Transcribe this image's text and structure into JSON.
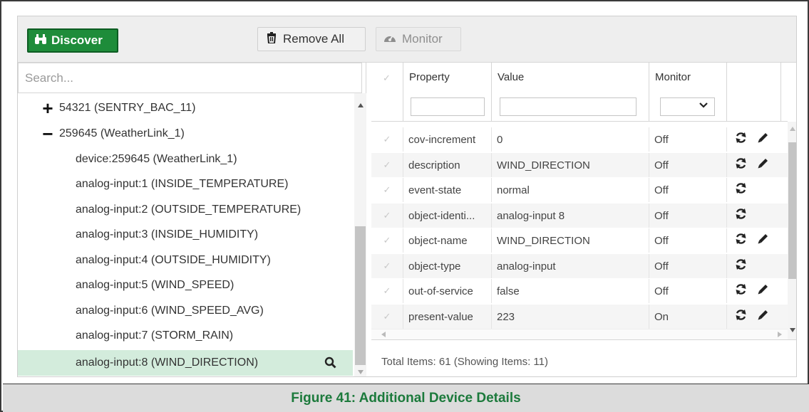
{
  "toolbar": {
    "discover_label": "Discover",
    "remove_all_label": "Remove All",
    "monitor_label": "Monitor"
  },
  "tree": {
    "search_placeholder": "Search...",
    "nodes": [
      {
        "expander": "+",
        "label": "54321 (SENTRY_BAC_11)"
      },
      {
        "expander": "−",
        "label": "259645 (WeatherLink_1)"
      },
      {
        "label": "device:259645 (WeatherLink_1)"
      },
      {
        "label": "analog-input:1 (INSIDE_TEMPERATURE)"
      },
      {
        "label": "analog-input:2 (OUTSIDE_TEMPERATURE)"
      },
      {
        "label": "analog-input:3 (INSIDE_HUMIDITY)"
      },
      {
        "label": "analog-input:4 (OUTSIDE_HUMIDITY)"
      },
      {
        "label": "analog-input:5 (WIND_SPEED)"
      },
      {
        "label": "analog-input:6 (WIND_SPEED_AVG)"
      },
      {
        "label": "analog-input:7 (STORM_RAIN)"
      },
      {
        "label": "analog-input:8 (WIND_DIRECTION)",
        "selected": true
      }
    ]
  },
  "grid": {
    "headers": {
      "property": "Property",
      "value": "Value",
      "monitor": "Monitor"
    },
    "rows": [
      {
        "property": "cov-increment",
        "value": "0",
        "monitor": "Off",
        "editable": true
      },
      {
        "property": "description",
        "value": "WIND_DIRECTION",
        "monitor": "Off",
        "editable": true
      },
      {
        "property": "event-state",
        "value": "normal",
        "monitor": "Off",
        "editable": false
      },
      {
        "property": "object-identi...",
        "value": "analog-input 8",
        "monitor": "Off",
        "editable": false
      },
      {
        "property": "object-name",
        "value": "WIND_DIRECTION",
        "monitor": "Off",
        "editable": true
      },
      {
        "property": "object-type",
        "value": "analog-input",
        "monitor": "Off",
        "editable": false
      },
      {
        "property": "out-of-service",
        "value": "false",
        "monitor": "Off",
        "editable": true
      },
      {
        "property": "present-value",
        "value": "223",
        "monitor": "On",
        "editable": true
      }
    ],
    "footer": "Total Items: 61 (Showing Items: 11)"
  },
  "caption": "Figure 41: Additional Device Details",
  "colors": {
    "accent_green": "#1e8c3a",
    "selected_row": "#d3ecdc",
    "caption_text": "#1c7a3c"
  }
}
